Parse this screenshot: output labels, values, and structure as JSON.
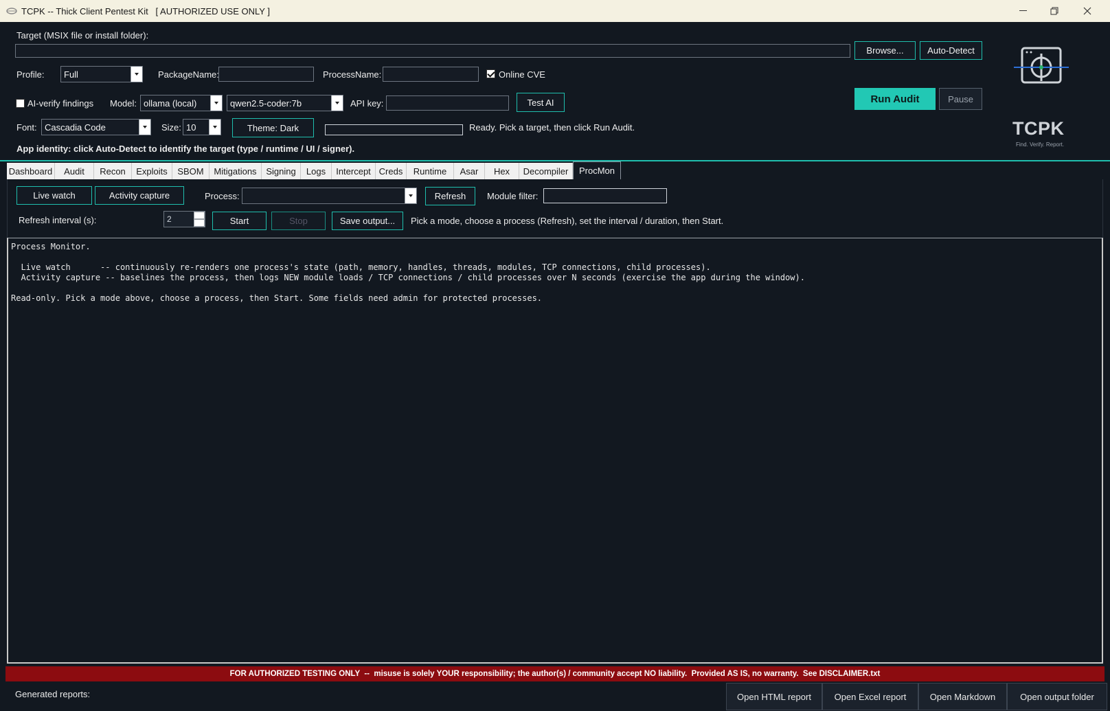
{
  "window": {
    "title": "TCPK -- Thick Client Pentest Kit   [ AUTHORIZED USE ONLY ]",
    "controls": [
      "minimize",
      "restore",
      "close"
    ]
  },
  "target": {
    "label": "Target (MSIX file or install folder):",
    "value": "",
    "browse_label": "Browse...",
    "autodetect_label": "Auto-Detect"
  },
  "profile": {
    "label": "Profile:",
    "value": "Full",
    "package_label": "PackageName:",
    "package_value": "",
    "process_label": "ProcessName:",
    "process_value": "",
    "online_cve_label": "Online CVE",
    "online_cve_checked": true
  },
  "actions": {
    "run_audit_label": "Run Audit",
    "pause_label": "Pause"
  },
  "ai": {
    "verify_label": "AI-verify findings",
    "verify_checked": false,
    "model_label": "Model:",
    "model_value": "ollama (local)",
    "model_name_value": "qwen2.5-coder:7b",
    "api_key_label": "API key:",
    "api_key_value": "",
    "test_label": "Test AI"
  },
  "appearance": {
    "font_label": "Font:",
    "font_value": "Cascadia Code",
    "size_label": "Size:",
    "size_value": "10",
    "theme_label": "Theme: Dark",
    "progress_fraction": 0,
    "status_text": "Ready. Pick a target, then click Run Audit."
  },
  "identity_text": "App identity: click Auto-Detect to identify the target (type / runtime / UI / signer).",
  "logo": {
    "title": "TCPK",
    "tagline": "Find. Verify. Report."
  },
  "tabs": [
    "Dashboard",
    "Audit",
    "Recon",
    "Exploits",
    "SBOM",
    "Mitigations",
    "Signing",
    "Logs",
    "Intercept",
    "Creds",
    "Runtime",
    "Asar",
    "Hex",
    "Decompiler",
    "ProcMon"
  ],
  "active_tab": "ProcMon",
  "procmon": {
    "live_watch_label": "Live watch",
    "activity_capture_label": "Activity capture",
    "process_label": "Process:",
    "process_value": "",
    "refresh_label": "Refresh",
    "module_filter_label": "Module filter:",
    "module_filter_value": "",
    "interval_label": "Refresh interval (s):",
    "interval_value": "2",
    "start_label": "Start",
    "stop_label": "Stop",
    "save_label": "Save output...",
    "hint": "Pick a mode,  choose a process (Refresh),  set the interval / duration, then Start."
  },
  "output": {
    "lines": [
      "Process Monitor.",
      "",
      "  Live watch      -- continuously re-renders one process's state (path, memory, handles, threads, modules, TCP connections, child processes).",
      "  Activity capture -- baselines the process, then logs NEW module loads / TCP connections / child processes over N seconds (exercise the app during the window).",
      "",
      "Read-only. Pick a mode above, choose a process, then Start. Some fields need admin for protected processes."
    ]
  },
  "disclaimer": "FOR AUTHORIZED TESTING ONLY  --  misuse is solely YOUR responsibility; the author(s) / community accept NO liability.  Provided AS IS, no warranty.  See DISCLAIMER.txt",
  "footer": {
    "label": "Generated reports:",
    "buttons": [
      "Open HTML report",
      "Open Excel report",
      "Open Markdown",
      "Open output folder"
    ]
  },
  "colors": {
    "accent": "#22c8b4",
    "background": "#121820",
    "disclaimer_bg": "#8c0c10",
    "titlebar_bg": "#f4f1e1"
  }
}
